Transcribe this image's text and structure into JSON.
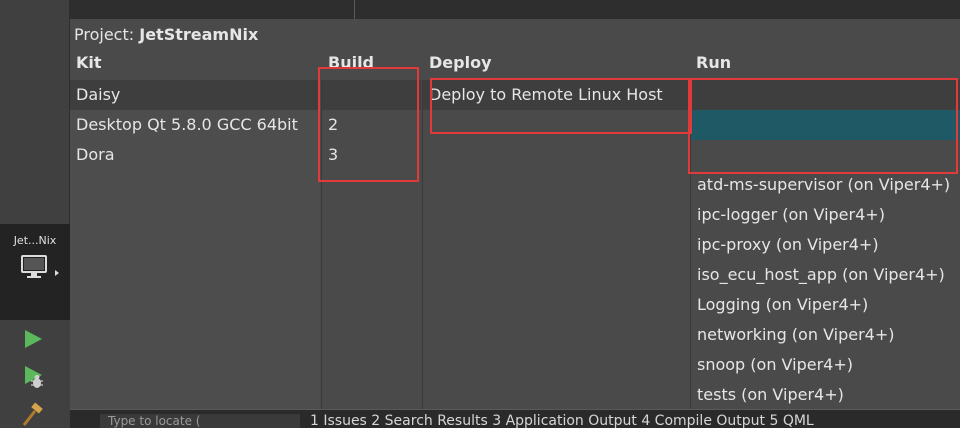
{
  "sidebar": {
    "kit_selector_label": "Jet...Nix",
    "icons": [
      "monitor-icon",
      "run-icon",
      "debug-run-icon",
      "build-hammer-icon"
    ]
  },
  "project": {
    "label": "Project:",
    "name": "JetStreamNix"
  },
  "headers": {
    "kit": "Kit",
    "build": "Build",
    "deploy": "Deploy",
    "run": "Run"
  },
  "kits": [
    "Daisy",
    "Desktop Qt 5.8.0 GCC 64bit",
    "Dora"
  ],
  "builds": [
    "",
    "2",
    "3"
  ],
  "deploys": [
    "Deploy to Remote Linux Host"
  ],
  "runs": [
    "",
    "",
    "",
    "atd-ms-supervisor (on Viper4+)",
    "ipc-logger (on Viper4+)",
    "ipc-proxy (on Viper4+)",
    "iso_ecu_host_app (on Viper4+)",
    "Logging (on Viper4+)",
    "networking (on Viper4+)",
    "snoop (on Viper4+)",
    "tests (on Viper4+)"
  ],
  "bottom": {
    "filter_placeholder": "Type to locate (",
    "panes": "1 Issues   2 Search Results   3 Application Output   4 Compile Output   5 QML"
  },
  "colors": {
    "annotation": "#e03a3a",
    "selection": "#1f5965"
  }
}
